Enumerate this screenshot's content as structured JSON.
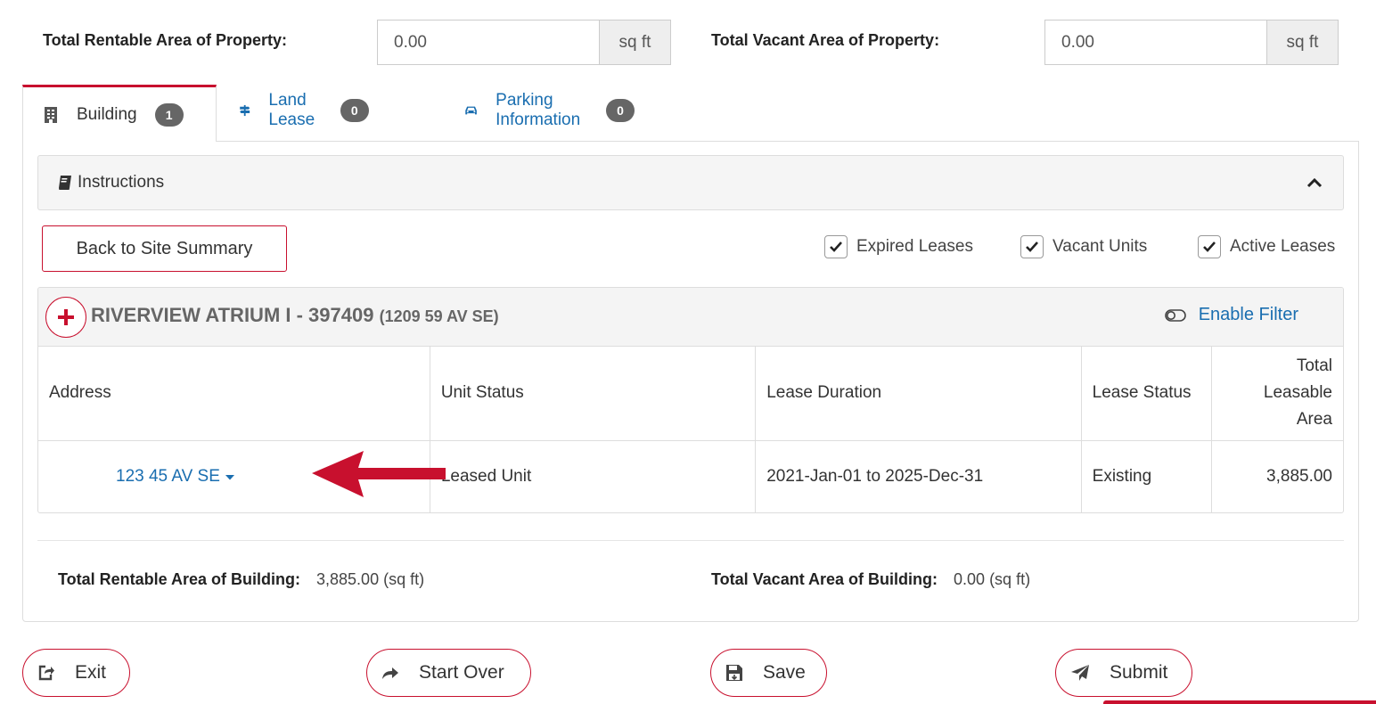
{
  "property": {
    "rentable_label": "Total Rentable Area of Property:",
    "rentable_value": "0.00",
    "rentable_unit": "sq ft",
    "vacant_label": "Total Vacant Area of Property:",
    "vacant_value": "0.00",
    "vacant_unit": "sq ft"
  },
  "tabs": [
    {
      "label": "Building",
      "count": "1",
      "icon": "building-icon"
    },
    {
      "label": "Land Lease",
      "count": "0",
      "icon": "signpost-icon"
    },
    {
      "label": "Parking Information",
      "count": "0",
      "icon": "car-icon"
    }
  ],
  "instructions": {
    "label": "Instructions",
    "icon": "book-icon"
  },
  "back_button": "Back to Site Summary",
  "filters": [
    {
      "label": "Expired Leases",
      "checked": true
    },
    {
      "label": "Vacant Units",
      "checked": true
    },
    {
      "label": "Active Leases",
      "checked": true
    }
  ],
  "building": {
    "name": "RIVERVIEW ATRIUM I - 397409",
    "address": "(1209 59 AV SE)",
    "enable_filter": "Enable Filter"
  },
  "table": {
    "headers": [
      "Address",
      "Unit Status",
      "Lease Duration",
      "Lease Status",
      "Total Leasable Area"
    ],
    "rows": [
      {
        "address": "123 45 AV SE",
        "unit_status": "Leased Unit",
        "lease_duration": "2021-Jan-01 to 2025-Dec-31",
        "lease_status": "Existing",
        "area": "3,885.00"
      }
    ]
  },
  "totals": {
    "rentable_label": "Total Rentable Area of Building:",
    "rentable_value": "3,885.00 (sq ft)",
    "vacant_label": "Total Vacant Area of Building:",
    "vacant_value": "0.00 (sq ft)"
  },
  "actions": {
    "exit": "Exit",
    "start_over": "Start Over",
    "save": "Save",
    "submit": "Submit"
  },
  "colors": {
    "accent": "#c8102e",
    "link": "#1a6eb0"
  }
}
